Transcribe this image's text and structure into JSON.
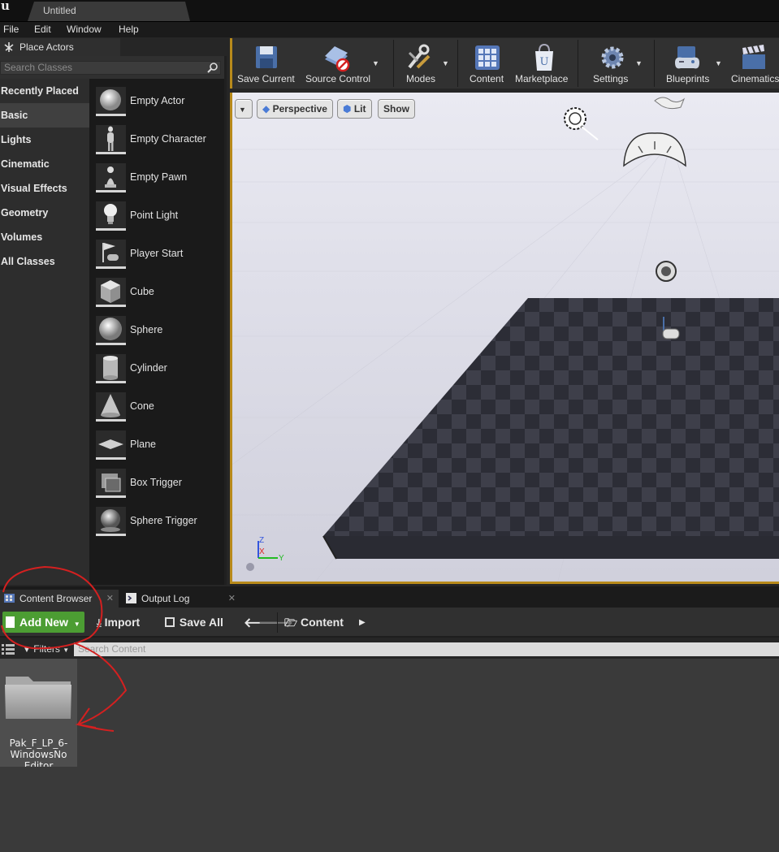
{
  "window": {
    "tab_title": "Untitled"
  },
  "menu": {
    "items": [
      "File",
      "Edit",
      "Window",
      "Help"
    ]
  },
  "place_actors": {
    "tab_label": "Place Actors",
    "search_placeholder": "Search Classes",
    "categories": [
      "Recently Placed",
      "Basic",
      "Lights",
      "Cinematic",
      "Visual Effects",
      "Geometry",
      "Volumes",
      "All Classes"
    ],
    "selected_category": "Basic",
    "actors": [
      "Empty Actor",
      "Empty Character",
      "Empty Pawn",
      "Point Light",
      "Player Start",
      "Cube",
      "Sphere",
      "Cylinder",
      "Cone",
      "Plane",
      "Box Trigger",
      "Sphere Trigger"
    ]
  },
  "toolbar": {
    "save_current": "Save Current",
    "source_control": "Source Control",
    "modes": "Modes",
    "content": "Content",
    "marketplace": "Marketplace",
    "settings": "Settings",
    "blueprints": "Blueprints",
    "cinematics": "Cinematics"
  },
  "viewport": {
    "perspective_label": "Perspective",
    "lit_label": "Lit",
    "show_label": "Show",
    "axis_z": "Z",
    "axis_x": "X",
    "axis_y": "Y"
  },
  "content_browser": {
    "tab_label": "Content Browser",
    "output_log_label": "Output Log",
    "add_new_label": "Add New",
    "import_label": "Import",
    "save_all_label": "Save All",
    "path_label": "Content",
    "filters_label": "Filters",
    "search_placeholder": "Search Content",
    "folder_name_line1": "Pak_F_LP_6-",
    "folder_name_line2": "WindowsNo",
    "folder_name_line3": "Editor"
  },
  "colors": {
    "accent_border": "#b88a1b",
    "add_new_green": "#4c9d33",
    "annotation_red": "#d42020"
  }
}
